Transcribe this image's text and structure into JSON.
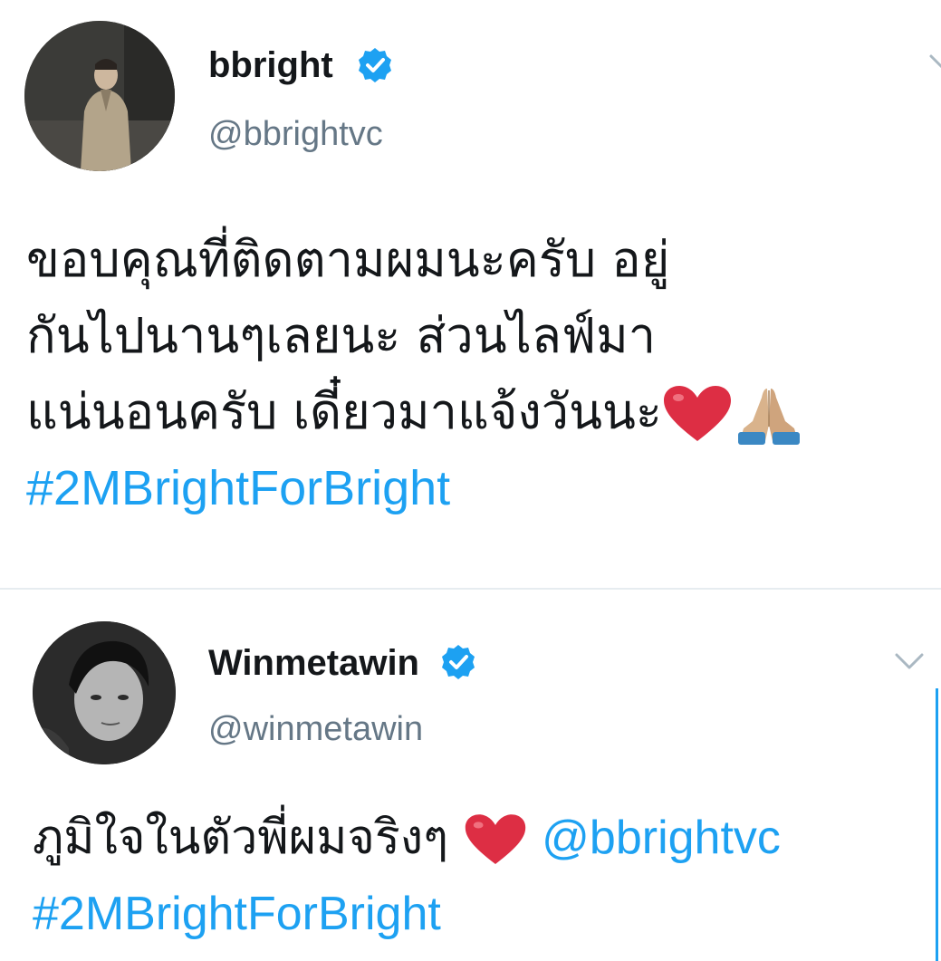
{
  "tweets": [
    {
      "display_name": "bbright",
      "handle": "@bbrightvc",
      "text_lines": [
        "ขอบคุณที่ติดตามผมนะครับ อยู่",
        "กันไปนานๆเลยนะ ส่วนไลฟ์มา",
        "แน่นอนครับ เดี๋ยวมาแจ้งวันนะ"
      ],
      "hashtag": "#2MBrightForBright",
      "emojis": [
        "red-heart",
        "folded-hands"
      ]
    },
    {
      "display_name": "Winmetawin",
      "handle": "@winmetawin",
      "text_line": "ภูมิใจในตัวพี่ผมจริงๆ",
      "mention": "@bbrightvc",
      "hashtag": "#2MBrightForBright",
      "emojis": [
        "red-heart"
      ]
    }
  ],
  "colors": {
    "link": "#1da1f2",
    "handle": "#657786",
    "text": "#14171a",
    "divider": "#e6ecf0",
    "verified": "#1da1f2"
  },
  "icons": [
    "verified-badge-icon",
    "chevron-down-icon",
    "red-heart-icon",
    "folded-hands-icon"
  ]
}
